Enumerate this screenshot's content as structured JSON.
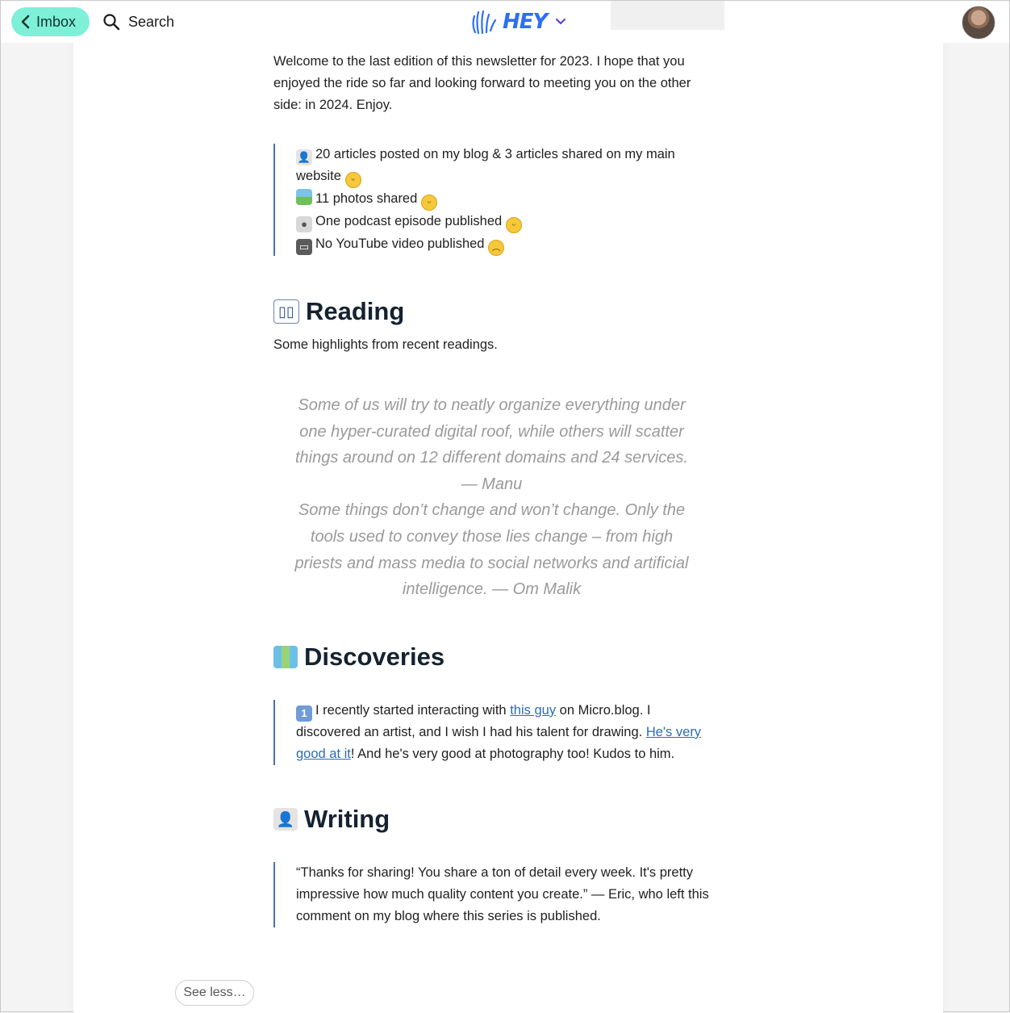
{
  "nav": {
    "back_label": "Imbox",
    "search_label": "Search",
    "logo_text": "HEY"
  },
  "intro": "Welcome to the last edition of this newsletter for 2023. I hope that you enjoyed the ride so far and looking forward to meeting you on the other side: in 2024. Enjoy.",
  "stats": {
    "line1": "20 articles posted on my blog & 3 articles shared on my main website",
    "line2": "11 photos shared",
    "line3": "One podcast episode published",
    "line4": "No YouTube video published"
  },
  "reading": {
    "heading": "Reading",
    "subtitle": "Some highlights from recent readings.",
    "quote1": "Some of us will try to neatly organize everything under one hyper-curated digital roof, while others will scatter things around on 12 different domains and 24 services. — Manu",
    "quote2": "Some things don’t change and won’t change. Only the tools used to convey those lies change – from high priests and mass media to social networks and artificial intelligence. — Om Malik"
  },
  "discoveries": {
    "heading": "Discoveries",
    "text_a": "I recently started interacting with ",
    "link1": "this guy",
    "text_b": " on Micro.blog. I discovered an artist, and I wish I had his talent for drawing. ",
    "link2": "He's very good at it",
    "text_c": "! And he's very good at photography too! Kudos to him."
  },
  "writing": {
    "heading": "Writing",
    "text": "“Thanks for sharing! You share a ton of detail every week. It's pretty impressive how much quality content you create.” — Eric, who left this comment on my blog where this series is published."
  },
  "see_less_label": "See less…"
}
